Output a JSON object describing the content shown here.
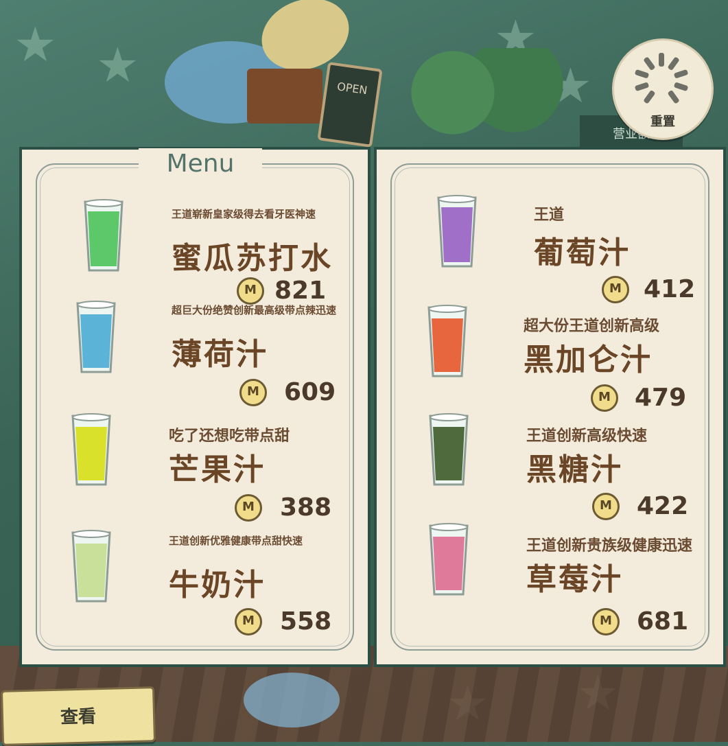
{
  "scene": {
    "open_sign": "OPEN",
    "sales_board": "营业额"
  },
  "reset_button": {
    "label": "重置"
  },
  "view_button": {
    "label": "查看"
  },
  "menu": {
    "title": "Menu",
    "left_items": [
      {
        "desc": "王道崭新皇家级得去看牙医神速",
        "name": "蜜瓜苏打水",
        "price": "821",
        "color": "#5cc86a"
      },
      {
        "desc": "超巨大份绝赞创新最高级带点辣迅速",
        "name": "薄荷汁",
        "price": "609",
        "color": "#5bb4d8"
      },
      {
        "desc": "吃了还想吃带点甜",
        "name": "芒果汁",
        "price": "388",
        "color": "#d9e12a"
      },
      {
        "desc": "王道创新优雅健康带点甜快速",
        "name": "牛奶汁",
        "price": "558",
        "color": "#c9e09a"
      }
    ],
    "right_items": [
      {
        "desc": "王道",
        "name": "葡萄汁",
        "price": "412",
        "color": "#a070c8"
      },
      {
        "desc": "超大份王道创新高级",
        "name": "黑加仑汁",
        "price": "479",
        "color": "#e8663e"
      },
      {
        "desc": "王道创新高级快速",
        "name": "黑糖汁",
        "price": "422",
        "color": "#4f6b3e"
      },
      {
        "desc": "王道创新贵族级健康迅速",
        "name": "草莓汁",
        "price": "681",
        "color": "#e07a9a"
      }
    ],
    "coin_symbol": "M"
  }
}
